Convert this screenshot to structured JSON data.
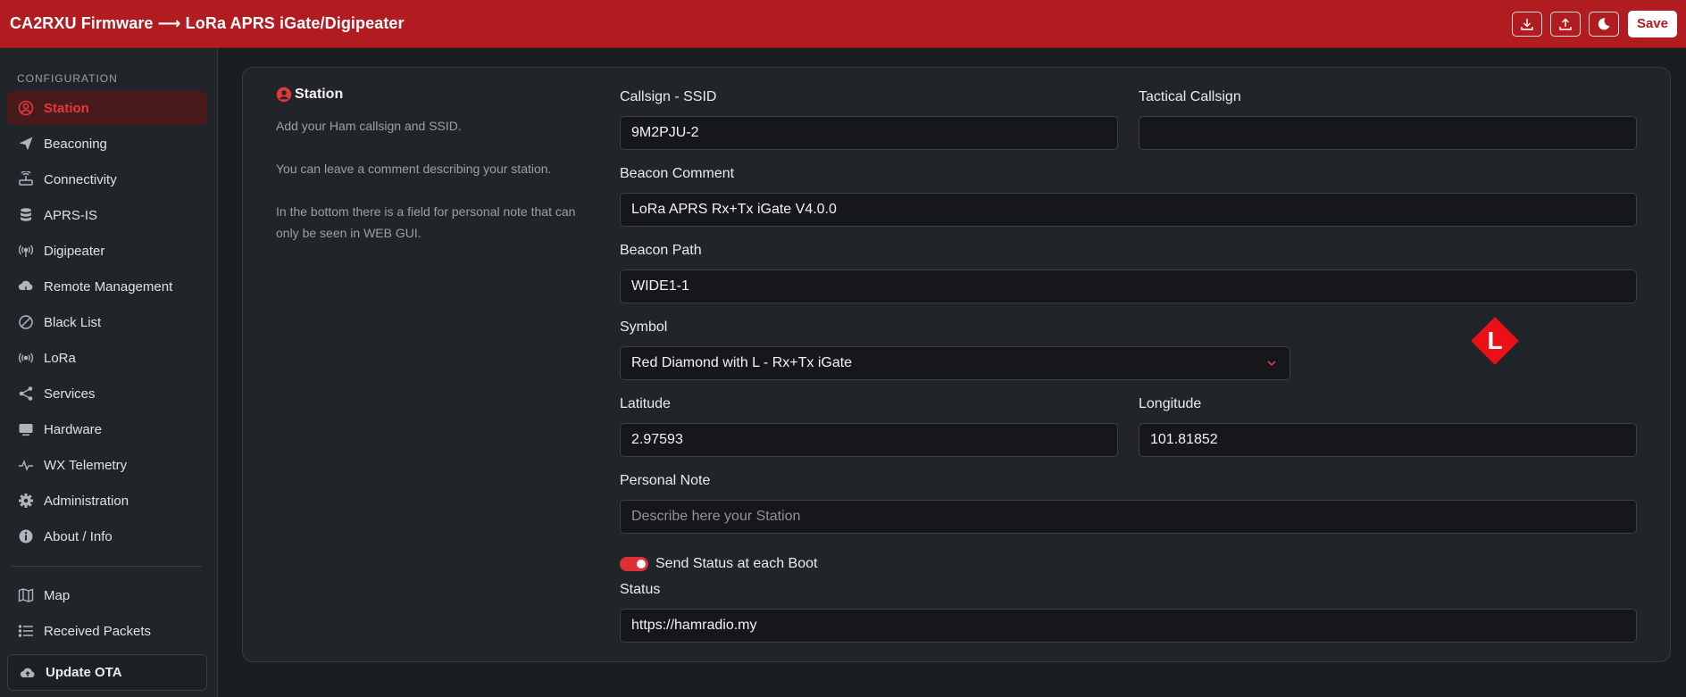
{
  "header": {
    "title": "CA2RXU Firmware ⟶ LoRa APRS iGate/Digipeater",
    "download_icon": "download-icon",
    "upload_icon": "upload-icon",
    "theme_icon": "moon-icon",
    "save_label": "Save",
    "accent_color": "#b01c20"
  },
  "sidebar": {
    "heading": "CONFIGURATION",
    "items": [
      {
        "label": "Station",
        "icon": "user-circle-icon",
        "active": true
      },
      {
        "label": "Beaconing",
        "icon": "paper-plane-icon"
      },
      {
        "label": "Connectivity",
        "icon": "router-icon"
      },
      {
        "label": "APRS-IS",
        "icon": "database-icon"
      },
      {
        "label": "Digipeater",
        "icon": "broadcast-icon"
      },
      {
        "label": "Remote Management",
        "icon": "cloud-icon"
      },
      {
        "label": "Black List",
        "icon": "ban-icon"
      },
      {
        "label": "LoRa",
        "icon": "signal-icon"
      },
      {
        "label": "Services",
        "icon": "share-icon"
      },
      {
        "label": "Hardware",
        "icon": "monitor-icon"
      },
      {
        "label": "WX Telemetry",
        "icon": "pulse-icon"
      },
      {
        "label": "Administration",
        "icon": "gear-icon"
      },
      {
        "label": "About / Info",
        "icon": "info-icon"
      }
    ],
    "extra_items": [
      {
        "label": "Map",
        "icon": "map-icon"
      },
      {
        "label": "Received Packets",
        "icon": "list-icon"
      }
    ],
    "ota_label": "Update OTA"
  },
  "station": {
    "title": "Station",
    "desc1": "Add your Ham callsign and SSID.",
    "desc2": "You can leave a comment describing your station.",
    "desc3": "In the bottom there is a field for personal note that can only be seen in WEB GUI.",
    "callsign_label": "Callsign - SSID",
    "callsign_value": "9M2PJU-2",
    "tactical_label": "Tactical Callsign",
    "tactical_value": "",
    "comment_label": "Beacon Comment",
    "comment_value": "LoRa APRS Rx+Tx iGate V4.0.0",
    "path_label": "Beacon Path",
    "path_value": "WIDE1-1",
    "symbol_label": "Symbol",
    "symbol_value": "Red Diamond with L - Rx+Tx iGate",
    "symbol_letter": "L",
    "latitude_label": "Latitude",
    "latitude_value": "2.97593",
    "longitude_label": "Longitude",
    "longitude_value": "101.81852",
    "note_label": "Personal Note",
    "note_placeholder": "Describe here your Station",
    "send_status_label": "Send Status at each Boot",
    "send_status_on": true,
    "status_label": "Status",
    "status_value": "https://hamradio.my"
  }
}
